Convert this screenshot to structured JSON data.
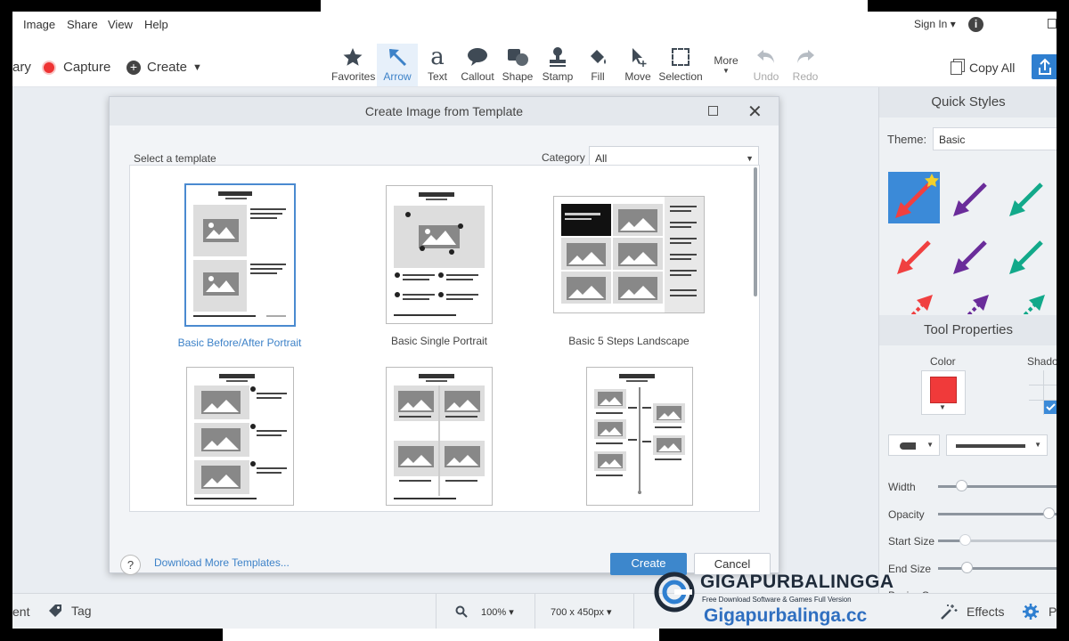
{
  "menu": {
    "items": [
      "Image",
      "Share",
      "View",
      "Help"
    ],
    "sign_in": "Sign In ▾"
  },
  "toolbar": {
    "library": "ary",
    "capture": "Capture",
    "create": "Create",
    "tools": [
      "Favorites",
      "Arrow",
      "Text",
      "Callout",
      "Shape",
      "Stamp",
      "Fill",
      "Move",
      "Selection"
    ],
    "more": "More",
    "undo": "Undo",
    "redo": "Redo",
    "copy_all": "Copy All"
  },
  "dialog": {
    "title": "Create Image from Template",
    "select_label": "Select a template",
    "category_label": "Category",
    "category_value": "All",
    "templates": [
      {
        "name": "Basic Before/After Portrait",
        "selected": true
      },
      {
        "name": "Basic Single Portrait",
        "selected": false
      },
      {
        "name": "Basic 5 Steps Landscape",
        "selected": false
      },
      {
        "name": "",
        "selected": false
      },
      {
        "name": "",
        "selected": false
      },
      {
        "name": "",
        "selected": false
      }
    ],
    "help": "?",
    "download_link": "Download More Templates...",
    "create": "Create",
    "cancel": "Cancel"
  },
  "panel": {
    "quick_styles": "Quick Styles",
    "theme_label": "Theme:",
    "theme_value": "Basic",
    "tool_properties": "Tool Properties",
    "color_label": "Color",
    "shadow_label": "Shado",
    "width": "Width",
    "opacity": "Opacity",
    "start_size": "Start Size",
    "end_size": "End Size",
    "bezier": "Bezier Curve",
    "accent_red": "#f04040",
    "accent_purple": "#6a2c9a",
    "accent_teal": "#12a98a"
  },
  "status": {
    "left_text": "ent",
    "tag": "Tag",
    "zoom": "100% ▾",
    "size": "700 x 450px ▾",
    "effects": "Effects",
    "props": "P"
  },
  "watermark": {
    "brand": "GIGAPURBALINGGA",
    "tagline": "Free Download Software & Games Full Version",
    "site": "Gigapurbalinga.cc"
  }
}
